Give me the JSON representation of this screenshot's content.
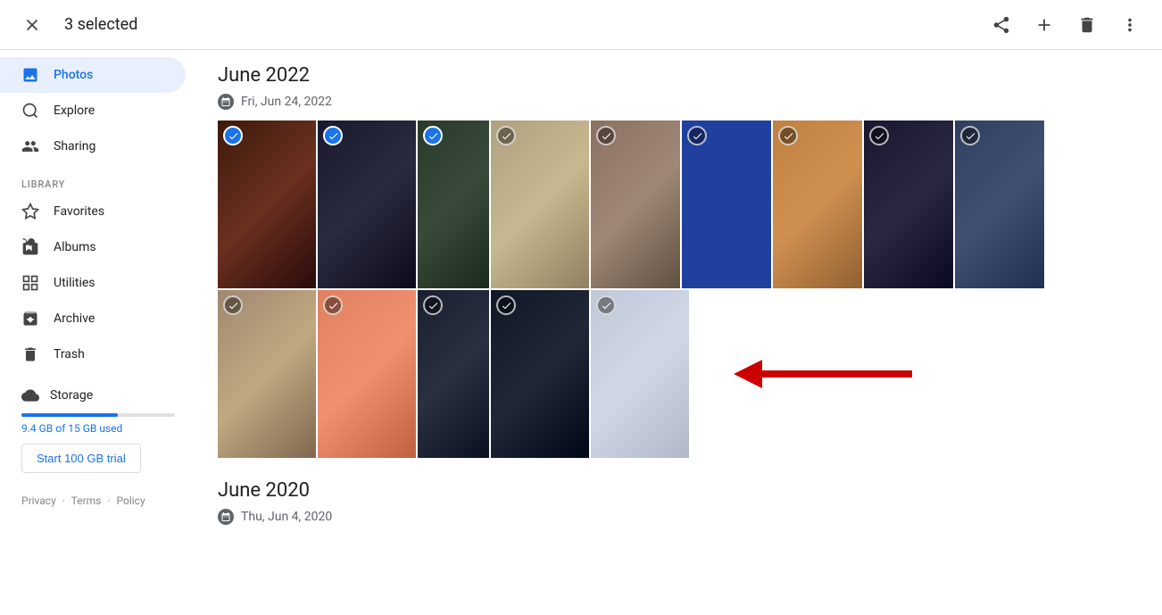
{
  "topbar": {
    "selected_label": "3 selected",
    "share_icon": "share",
    "add_icon": "add",
    "delete_icon": "delete",
    "more_icon": "more-vert"
  },
  "sidebar": {
    "photos_label": "Photos",
    "explore_label": "Explore",
    "sharing_label": "Sharing",
    "library_section": "LIBRARY",
    "favorites_label": "Favorites",
    "albums_label": "Albums",
    "utilities_label": "Utilities",
    "archive_label": "Archive",
    "trash_label": "Trash",
    "storage_label": "Storage",
    "storage_used": "9.4 GB of 15 GB used",
    "storage_trial_btn": "Start 100 GB trial",
    "storage_pct": 63,
    "footer": {
      "privacy": "Privacy",
      "terms": "Terms",
      "policy": "Policy"
    }
  },
  "content": {
    "sections": [
      {
        "month": "June 2022",
        "date": "Fri, Jun 24, 2022",
        "row1_photos": [
          {
            "selected": true,
            "color": "c1"
          },
          {
            "selected": true,
            "color": "c2"
          },
          {
            "selected": true,
            "color": "c3"
          },
          {
            "selected": false,
            "color": "c4"
          },
          {
            "selected": false,
            "color": "c5"
          },
          {
            "selected": false,
            "color": "c6"
          },
          {
            "selected": false,
            "color": "c7"
          },
          {
            "selected": false,
            "color": "c8"
          },
          {
            "selected": false,
            "color": "c9"
          }
        ],
        "row2_photos": [
          {
            "selected": false,
            "color": "c10"
          },
          {
            "selected": false,
            "color": "c11"
          },
          {
            "selected": false,
            "color": "c12"
          },
          {
            "selected": false,
            "color": "c13"
          },
          {
            "selected": false,
            "color": "c14"
          }
        ]
      },
      {
        "month": "June 2020",
        "date": "Thu, Jun 4, 2020"
      }
    ]
  }
}
